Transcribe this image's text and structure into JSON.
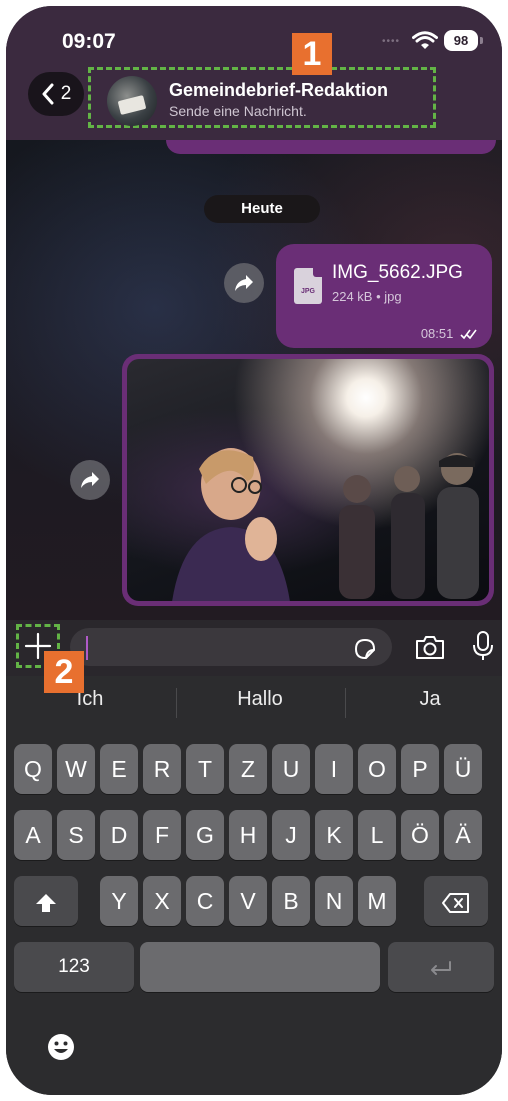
{
  "status_bar": {
    "time": "09:07",
    "battery": "98"
  },
  "header": {
    "back_count": "2",
    "chat_name": "Gemeindebrief-Redaktion",
    "chat_subtitle": "Sende eine Nachricht."
  },
  "annotations": {
    "badge_1": "1",
    "badge_2": "2"
  },
  "chat": {
    "date_separator": "Heute",
    "file_message": {
      "icon_label": "JPG",
      "file_name": "IMG_5662.JPG",
      "file_meta": "224 kB • jpg",
      "time": "08:51"
    }
  },
  "input": {
    "placeholder": ""
  },
  "keyboard": {
    "suggestions": [
      "Ich",
      "Hallo",
      "Ja"
    ],
    "row1": [
      "Q",
      "W",
      "E",
      "R",
      "T",
      "Z",
      "U",
      "I",
      "O",
      "P",
      "Ü"
    ],
    "row2": [
      "A",
      "S",
      "D",
      "F",
      "G",
      "H",
      "J",
      "K",
      "L",
      "Ö",
      "Ä"
    ],
    "row3": [
      "Y",
      "X",
      "C",
      "V",
      "B",
      "N",
      "M"
    ],
    "numbers_key": "123"
  },
  "colors": {
    "header_bg": "#3b2a3f",
    "bubble": "#6a2e76",
    "highlight": "#63b446",
    "badge": "#e8702f"
  }
}
